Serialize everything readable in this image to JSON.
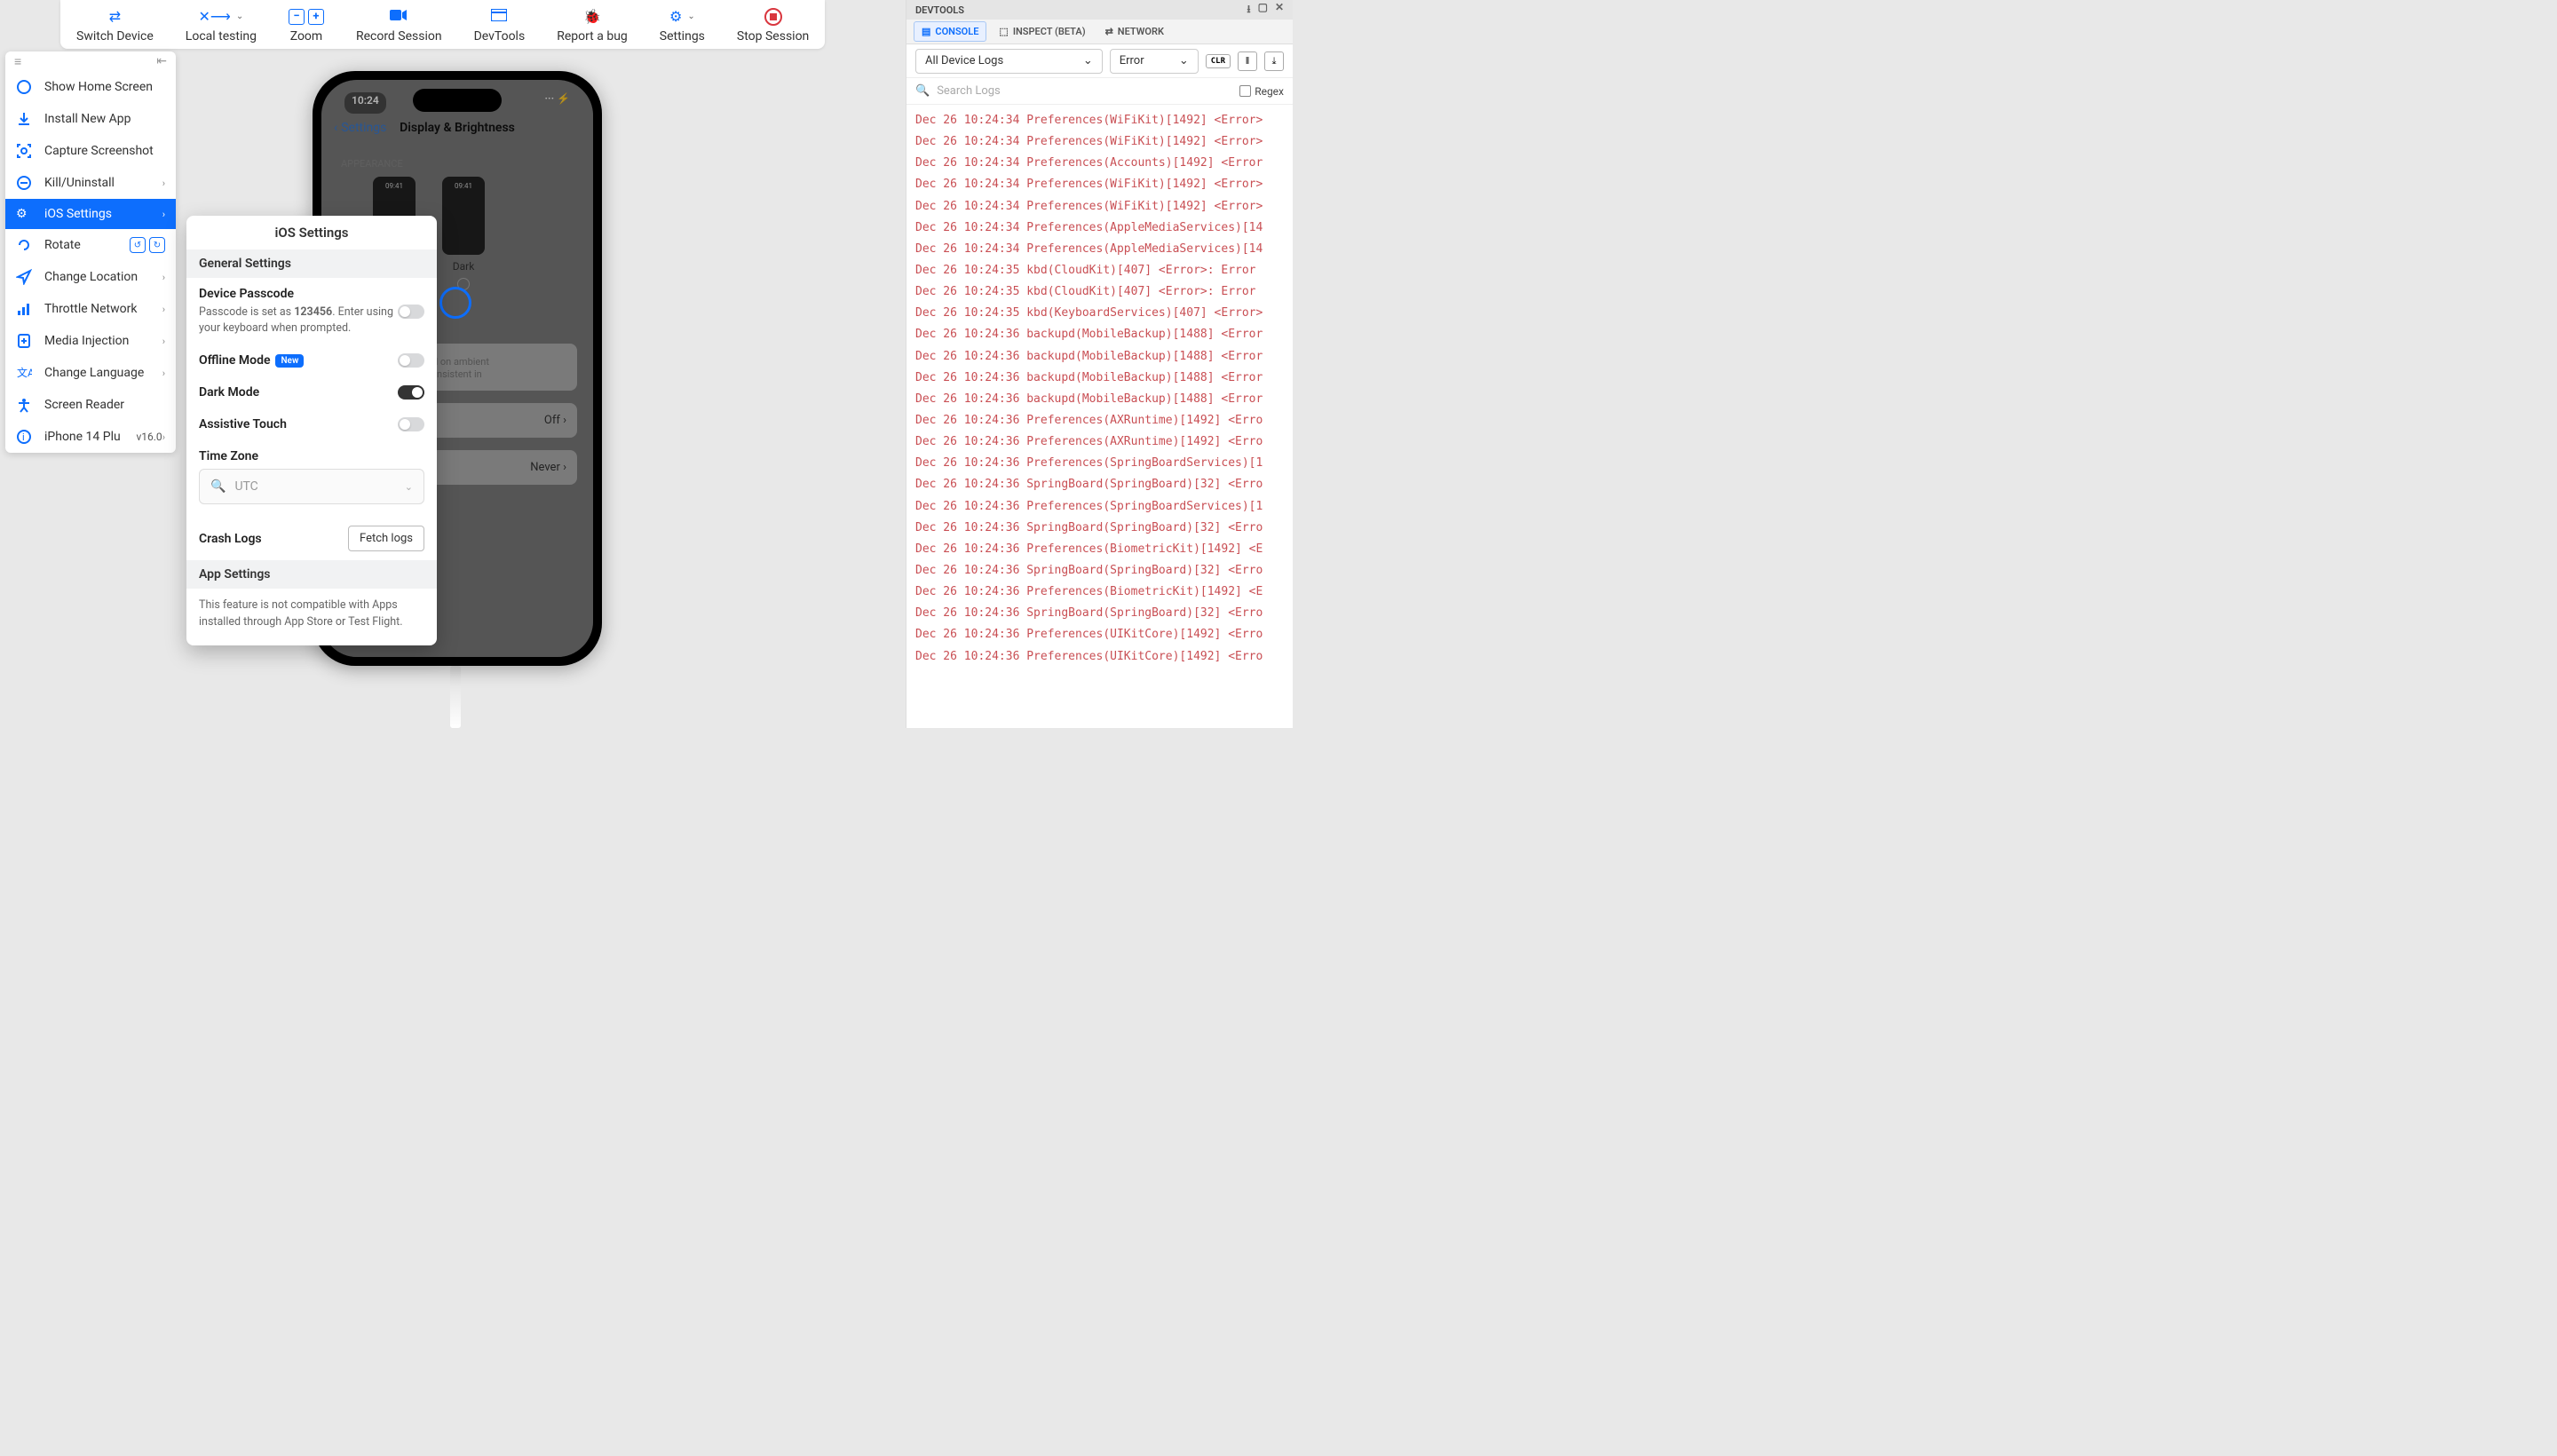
{
  "toolbar": {
    "switch_device": "Switch Device",
    "local_testing": "Local testing",
    "zoom": "Zoom",
    "record": "Record Session",
    "devtools": "DevTools",
    "bug": "Report a bug",
    "settings": "Settings",
    "stop": "Stop Session"
  },
  "sidebar": {
    "items": [
      {
        "label": "Show Home Screen"
      },
      {
        "label": "Install New App"
      },
      {
        "label": "Capture Screenshot"
      },
      {
        "label": "Kill/Uninstall"
      },
      {
        "label": "iOS Settings"
      },
      {
        "label": "Rotate"
      },
      {
        "label": "Change Location"
      },
      {
        "label": "Throttle Network"
      },
      {
        "label": "Media Injection"
      },
      {
        "label": "Change Language"
      },
      {
        "label": "Screen Reader"
      }
    ],
    "device_name": "iPhone 14 Plu",
    "device_version": "v16.0"
  },
  "ios_panel": {
    "title": "iOS Settings",
    "general_header": "General Settings",
    "passcode_title": "Device Passcode",
    "passcode_sub_pre": "Passcode is set as ",
    "passcode_value": "123456",
    "passcode_sub_post": ". Enter using your keyboard when prompted.",
    "offline_title": "Offline Mode",
    "offline_badge": "New",
    "dark_title": "Dark Mode",
    "assistive_title": "Assistive Touch",
    "timezone_title": "Time Zone",
    "timezone_value": "UTC",
    "crash_title": "Crash Logs",
    "fetch_label": "Fetch logs",
    "app_header": "App Settings",
    "app_note": "This feature is not compatible with Apps installed through App Store or Test Flight."
  },
  "phone": {
    "time": "10:24",
    "back_label": "Settings",
    "page_title": "Display & Brightness",
    "appearance_header": "APPEARANCE",
    "thumb_time": "09:41",
    "dark_label": "Dark",
    "off_label": "Off",
    "never_label": "Never"
  },
  "devtools": {
    "title": "DEVTOOLS",
    "tabs": {
      "console": "CONSOLE",
      "inspect": "INSPECT (BETA)",
      "network": "NETWORK"
    },
    "filter_source": "All Device Logs",
    "filter_level": "Error",
    "clr": "CLR",
    "search_placeholder": "Search Logs",
    "regex_label": "Regex",
    "logs": [
      "Dec 26 10:24:34 Preferences(WiFiKit)[1492] <Error>",
      "Dec 26 10:24:34 Preferences(WiFiKit)[1492] <Error>",
      "Dec 26 10:24:34 Preferences(Accounts)[1492] <Error",
      "Dec 26 10:24:34 Preferences(WiFiKit)[1492] <Error>",
      "Dec 26 10:24:34 Preferences(WiFiKit)[1492] <Error>",
      "Dec 26 10:24:34 Preferences(AppleMediaServices)[14",
      "Dec 26 10:24:34 Preferences(AppleMediaServices)[14",
      "Dec 26 10:24:35 kbd(CloudKit)[407] <Error>: Error",
      "Dec 26 10:24:35 kbd(CloudKit)[407] <Error>: Error",
      "Dec 26 10:24:35 kbd(KeyboardServices)[407] <Error>",
      "Dec 26 10:24:36 backupd(MobileBackup)[1488] <Error",
      "Dec 26 10:24:36 backupd(MobileBackup)[1488] <Error",
      "Dec 26 10:24:36 backupd(MobileBackup)[1488] <Error",
      "Dec 26 10:24:36 backupd(MobileBackup)[1488] <Error",
      "Dec 26 10:24:36 Preferences(AXRuntime)[1492] <Erro",
      "Dec 26 10:24:36 Preferences(AXRuntime)[1492] <Erro",
      "Dec 26 10:24:36 Preferences(SpringBoardServices)[1",
      "Dec 26 10:24:36 SpringBoard(SpringBoard)[32] <Erro",
      "Dec 26 10:24:36 Preferences(SpringBoardServices)[1",
      "Dec 26 10:24:36 SpringBoard(SpringBoard)[32] <Erro",
      "Dec 26 10:24:36 Preferences(BiometricKit)[1492] <E",
      "Dec 26 10:24:36 SpringBoard(SpringBoard)[32] <Erro",
      "Dec 26 10:24:36 Preferences(BiometricKit)[1492] <E",
      "Dec 26 10:24:36 SpringBoard(SpringBoard)[32] <Erro",
      "Dec 26 10:24:36 Preferences(UIKitCore)[1492] <Erro",
      "Dec 26 10:24:36 Preferences(UIKitCore)[1492] <Erro"
    ]
  }
}
